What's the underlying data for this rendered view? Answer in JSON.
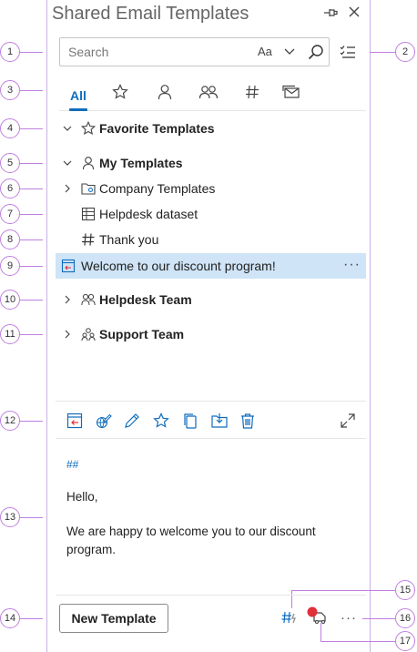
{
  "header": {
    "title": "Shared Email Templates"
  },
  "search": {
    "placeholder": "Search",
    "match_case_label": "Aa"
  },
  "tabs": [
    {
      "id": "all",
      "label": "All",
      "active": true
    },
    {
      "id": "favorites",
      "icon": "star-icon"
    },
    {
      "id": "my",
      "icon": "person-icon"
    },
    {
      "id": "team",
      "icon": "people-icon"
    },
    {
      "id": "tags",
      "icon": "hash-icon"
    },
    {
      "id": "shared",
      "icon": "envelope-stack-icon"
    }
  ],
  "tree": {
    "favorite_templates": "Favorite Templates",
    "my_templates": "My Templates",
    "company_templates": "Company Templates",
    "helpdesk_dataset": "Helpdesk dataset",
    "thank_you": "Thank you",
    "welcome": "Welcome to our discount program!",
    "helpdesk_team": "Helpdesk Team",
    "support_team": "Support Team"
  },
  "preview": {
    "hash": "##",
    "greeting": "Hello,",
    "body": "We are happy to welcome you to our discount program."
  },
  "footer": {
    "new_template_label": "New Template",
    "more": "···"
  },
  "callouts": [
    "1",
    "2",
    "3",
    "4",
    "5",
    "6",
    "7",
    "8",
    "9",
    "10",
    "11",
    "12",
    "13",
    "14",
    "15",
    "16",
    "17"
  ],
  "colors": {
    "accent": "#0f6cbd",
    "selected_bg": "#cfe4f6",
    "callout": "#c07fe0",
    "status_dot": "#e0303a"
  }
}
